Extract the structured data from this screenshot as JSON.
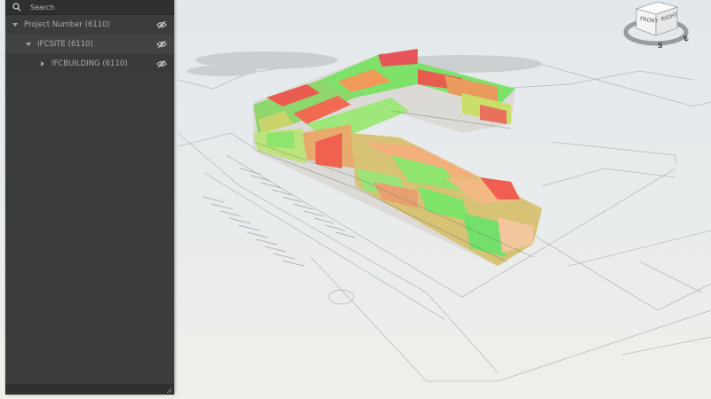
{
  "search": {
    "placeholder": "Search"
  },
  "tree": [
    {
      "label": "Project Number (6110)",
      "expanded": true,
      "hidden_toggle": "eye-hidden"
    },
    {
      "label": "IFCSITE (6110)",
      "expanded": true,
      "hidden_toggle": "eye-hidden"
    },
    {
      "label": "IFCBUILDING (6110)",
      "expanded": false,
      "hidden_toggle": "eye-hidden"
    }
  ],
  "viewcube": {
    "front": "FRONT",
    "right": "RIGHT",
    "compass_south": "S",
    "compass_east": "E"
  },
  "colors": {
    "panel": "#3b3d3c",
    "heat_high": "#ee5a4e",
    "heat_mid": "#e9a86a",
    "heat_low": "#6fe86a"
  }
}
